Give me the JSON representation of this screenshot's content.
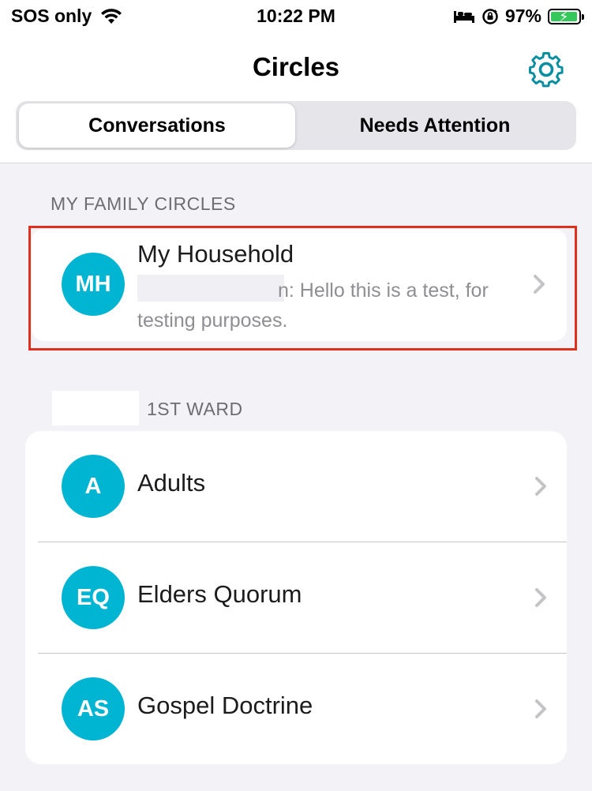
{
  "status_bar": {
    "carrier": "SOS only",
    "time": "10:22 PM",
    "battery": "97%",
    "battery_level": 0.97
  },
  "nav": {
    "title": "Circles",
    "settings_icon": "gear-icon",
    "accent_color": "#0a8ea0"
  },
  "tabs": [
    {
      "label": "Conversations",
      "selected": true
    },
    {
      "label": "Needs Attention",
      "selected": false
    }
  ],
  "sections": [
    {
      "header": "MY FAMILY CIRCLES",
      "items": [
        {
          "initials": "MH",
          "name": "My Household",
          "preview_tail": "n: Hello this is a test, for testing purposes."
        }
      ]
    },
    {
      "header": "1ST WARD",
      "items": [
        {
          "initials": "A",
          "name": "Adults"
        },
        {
          "initials": "EQ",
          "name": "Elders Quorum"
        },
        {
          "initials": "AS",
          "name": "Gospel Doctrine"
        }
      ]
    }
  ],
  "colors": {
    "avatar": "#00b5d1",
    "highlight": "#e0301e",
    "background": "#f2f2f7"
  }
}
